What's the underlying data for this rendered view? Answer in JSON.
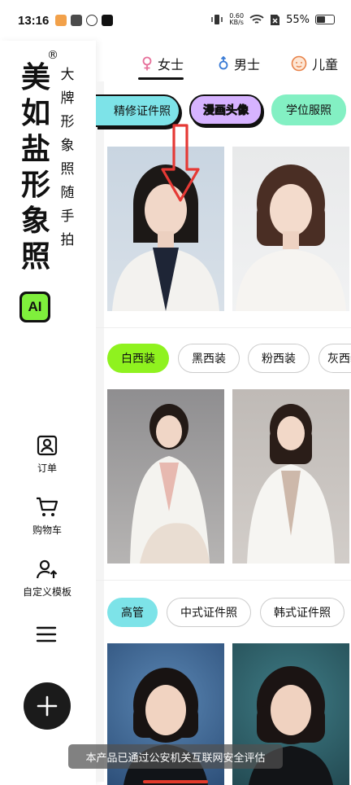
{
  "status_bar": {
    "time": "13:16",
    "net_speed_value": "0.60",
    "net_speed_unit": "KB/s",
    "battery": "55%",
    "battery_level": 0.55
  },
  "brand": {
    "registered": "®",
    "main_chars": [
      "美",
      "如",
      "盐",
      "形",
      "象",
      "照"
    ],
    "sub_chars": [
      "大",
      "牌",
      "形",
      "象",
      "照",
      "随",
      "手",
      "拍"
    ],
    "ai_badge": "AI"
  },
  "sidebar": {
    "items": [
      {
        "label": "订单",
        "icon": "portrait-id-icon"
      },
      {
        "label": "购物车",
        "icon": "cart-icon"
      },
      {
        "label": "自定义模板",
        "icon": "user-upload-icon"
      }
    ],
    "menu_icon": "menu-icon",
    "add_icon": "plus-icon"
  },
  "gender_tabs": [
    {
      "label": "女士",
      "icon": "female-icon",
      "active": true
    },
    {
      "label": "男士",
      "icon": "male-icon",
      "active": false
    },
    {
      "label": "儿童",
      "icon": "child-face-icon",
      "active": false
    }
  ],
  "top_chips": [
    {
      "label": "精修证件照",
      "style": "cyan-outline"
    },
    {
      "label": "漫画头像",
      "style": "purple-outline"
    },
    {
      "label": "学位服照",
      "style": "mint"
    }
  ],
  "style_chips_1": [
    {
      "label": "白西装",
      "active": true
    },
    {
      "label": "黑西装",
      "active": false
    },
    {
      "label": "粉西装",
      "active": false
    },
    {
      "label": "灰西装",
      "active": false
    }
  ],
  "style_chips_2": [
    {
      "label": "高管",
      "active": true
    },
    {
      "label": "中式证件照",
      "active": false
    },
    {
      "label": "韩式证件照",
      "active": false
    }
  ],
  "toast": "本产品已通过公安机关互联网安全评估",
  "colors": {
    "accent_green": "#8ff21f",
    "accent_cyan": "#7de3e8",
    "accent_mint": "#83f0c3",
    "accent_purple": "#d6b3ff",
    "arrow_red": "#e53935"
  }
}
